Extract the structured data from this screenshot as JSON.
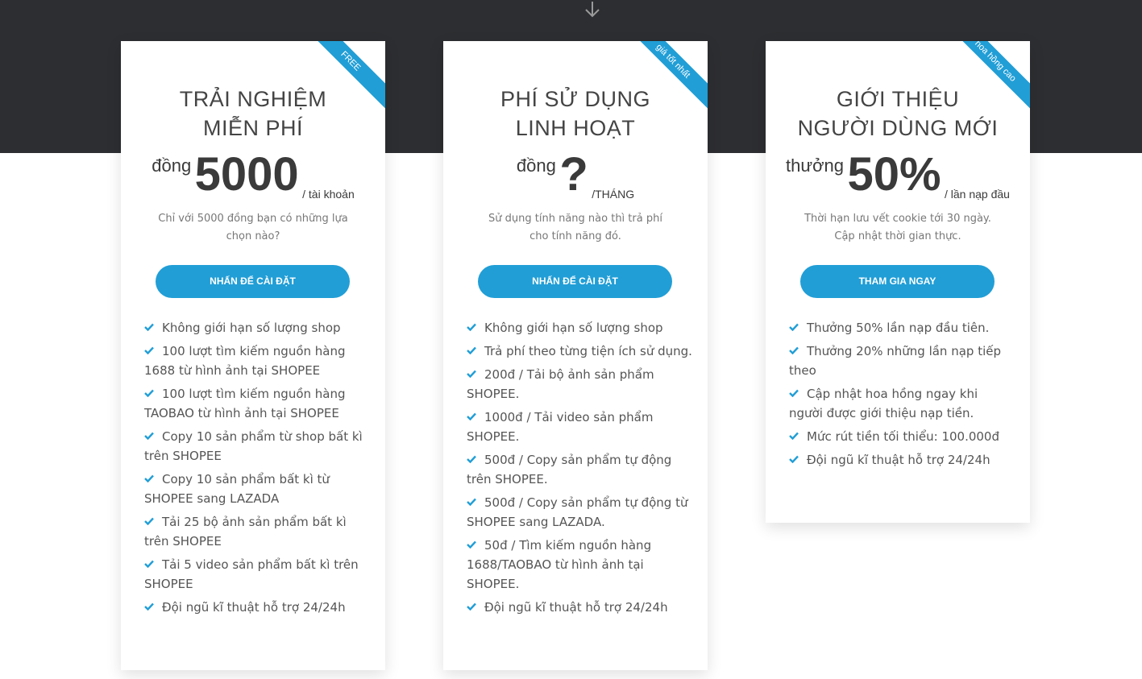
{
  "colors": {
    "accent": "#219ed6",
    "dark_band": "#2d2e31",
    "text": "#555555"
  },
  "icons": {
    "scroll": "arrow-down-icon",
    "bullet": "check-icon"
  },
  "plans": [
    {
      "ribbon": "FREE",
      "title_line1": "TRẢI NGHIỆM",
      "title_line2": "MIỄN PHÍ",
      "currency": "đồng",
      "amount": "5000",
      "period": "/ tài khoản",
      "description": "Chỉ với 5000 đồng bạn có những lựa chọn nào?",
      "button_label": "NHẤN ĐỂ CÀI ĐẶT",
      "features": [
        "Không giới hạn số lượng shop",
        "100 lượt tìm kiếm nguồn hàng 1688 từ hình ảnh tại SHOPEE",
        "100 lượt tìm kiếm nguồn hàng TAOBAO từ hình ảnh tại SHOPEE",
        "Copy 10 sản phẩm từ shop bất kì trên SHOPEE",
        "Copy 10 sản phẩm bất kì từ SHOPEE sang LAZADA",
        "Tải 25 bộ ảnh sản phẩm bất kì trên SHOPEE",
        "Tải 5 video sản phẩm bất kì trên SHOPEE",
        "Đội ngũ kĩ thuật hỗ trợ 24/24h"
      ]
    },
    {
      "ribbon": "giá tốt nhất",
      "title_line1": "PHÍ SỬ DỤNG",
      "title_line2": "LINH HOẠT",
      "currency": "đồng",
      "amount": "?",
      "period": "/THÁNG",
      "description": "Sử dụng tính năng nào thì trả phí cho tính năng đó.",
      "button_label": "NHẤN ĐỂ CÀI ĐẶT",
      "features": [
        "Không giới hạn số lượng shop",
        "Trả phí theo từng tiện ích sử dụng.",
        "200đ / Tải bộ ảnh sản phẩm SHOPEE.",
        "1000đ / Tải video sản phẩm SHOPEE.",
        "500đ / Copy sản phẩm tự động trên SHOPEE.",
        "500đ / Copy sản phẩm tự động từ SHOPEE sang LAZADA.",
        "50đ / Tìm kiếm nguồn hàng 1688/TAOBAO từ hình ảnh tại SHOPEE.",
        "Đội ngũ kĩ thuật hỗ trợ 24/24h"
      ]
    },
    {
      "ribbon": "hoa hồng cao",
      "title_line1": "GIỚI THIỆU",
      "title_line2": "NGƯỜI DÙNG MỚI",
      "currency": "thưởng",
      "amount": "50%",
      "period": "/ lần nạp đầu",
      "description": "Thời hạn lưu vết cookie tới 30 ngày. Cập nhật thời gian thực.",
      "button_label": "THAM GIA NGAY",
      "features": [
        "Thưởng 50% lần nạp đầu tiên.",
        "Thưởng 20% những lần nạp tiếp theo",
        "Cập nhật hoa hồng ngay khi người được giới thiệu nạp tiền.",
        "Mức rút tiền tối thiểu: 100.000đ",
        "Đội ngũ kĩ thuật hỗ trợ 24/24h"
      ]
    }
  ]
}
